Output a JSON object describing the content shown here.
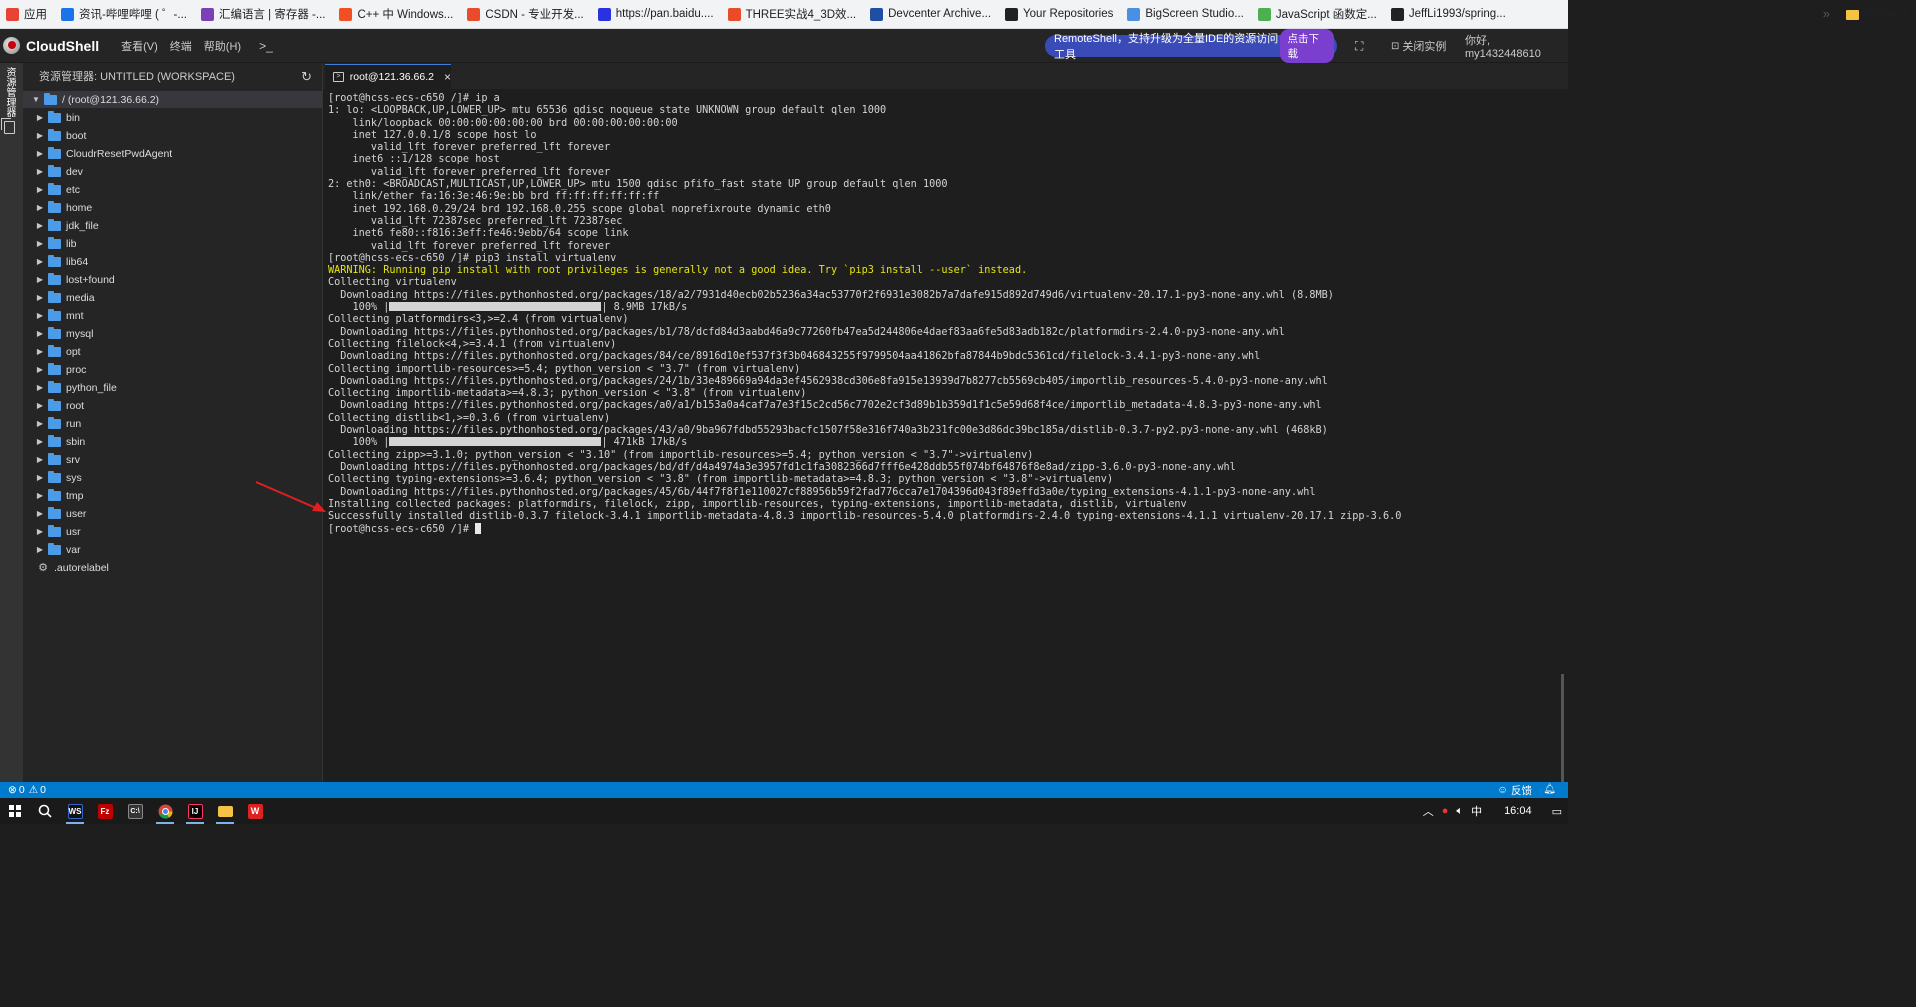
{
  "bookmarks": [
    {
      "label": "应用",
      "icon": "apps-grid-icon",
      "color": "#ea4335"
    },
    {
      "label": "资讯-哔哩哔哩 ( ゜-...",
      "icon": "bilibili-icon",
      "color": "#1a73e8"
    },
    {
      "label": "汇编语言 | 寄存器 -...",
      "icon": "visualstudio-icon",
      "color": "#7b3fb8"
    },
    {
      "label": "C++ 中 Windows...",
      "icon": "microsoft-icon",
      "color": "#f25022"
    },
    {
      "label": "CSDN - 专业开发...",
      "icon": "csdn-icon",
      "color": "#e94b2b"
    },
    {
      "label": "https://pan.baidu....",
      "icon": "baidu-icon",
      "color": "#2932e1"
    },
    {
      "label": "THREE实战4_3D效...",
      "icon": "csdn-icon",
      "color": "#e94b2b"
    },
    {
      "label": "Devcenter Archive...",
      "icon": "w-icon",
      "color": "#1f4fa3"
    },
    {
      "label": "Your Repositories",
      "icon": "github-icon",
      "color": "#222222"
    },
    {
      "label": "BigScreen Studio...",
      "icon": "bigscreen-icon",
      "color": "#4a90e2"
    },
    {
      "label": "JavaScript 函数定...",
      "icon": "globe-icon",
      "color": "#4caf50"
    },
    {
      "label": "JeffLi1993/spring...",
      "icon": "github-icon",
      "color": "#222222"
    }
  ],
  "bookmarks_more": "»",
  "bookmarks_all": "所有书签",
  "app": {
    "title": "CloudShell",
    "menus": [
      "查看(V)",
      "终端",
      "帮助(H)"
    ],
    "terminal_icon": "terminal-icon",
    "promo_text": "RemoteShell，支持升级为全量IDE的资源访问工具",
    "promo_button": "点击下载",
    "close_instance": "关闭实例",
    "greeting": "你好, my1432448610"
  },
  "activity": {
    "label": "资源管理器"
  },
  "explorer": {
    "header": "资源管理器: UNTITLED (WORKSPACE)",
    "root": "/ (root@121.36.66.2)",
    "items": [
      "bin",
      "boot",
      "CloudrResetPwdAgent",
      "dev",
      "etc",
      "home",
      "jdk_file",
      "lib",
      "lib64",
      "lost+found",
      "media",
      "mnt",
      "mysql",
      "opt",
      "proc",
      "python_file",
      "root",
      "run",
      "sbin",
      "srv",
      "sys",
      "tmp",
      "user",
      "usr",
      "var"
    ],
    "file": ".autorelabel"
  },
  "tab": {
    "label": "root@121.36.66.2",
    "close": "×"
  },
  "terminal": {
    "lines": [
      "[root@hcss-ecs-c650 /]# ip a",
      "1: lo: <LOOPBACK,UP,LOWER_UP> mtu 65536 qdisc noqueue state UNKNOWN group default qlen 1000",
      "    link/loopback 00:00:00:00:00:00 brd 00:00:00:00:00:00",
      "    inet 127.0.0.1/8 scope host lo",
      "       valid_lft forever preferred_lft forever",
      "    inet6 ::1/128 scope host",
      "       valid_lft forever preferred_lft forever",
      "2: eth0: <BROADCAST,MULTICAST,UP,LOWER_UP> mtu 1500 qdisc pfifo_fast state UP group default qlen 1000",
      "    link/ether fa:16:3e:46:9e:bb brd ff:ff:ff:ff:ff:ff",
      "    inet 192.168.0.29/24 brd 192.168.0.255 scope global noprefixroute dynamic eth0",
      "       valid_lft 72387sec preferred_lft 72387sec",
      "    inet6 fe80::f816:3eff:fe46:9ebb/64 scope link",
      "       valid_lft forever preferred_lft forever",
      "[root@hcss-ecs-c650 /]# pip3 install virtualenv",
      "WARNING: Running pip install with root privileges is generally not a good idea. Try `pip3 install --user` instead.",
      "Collecting virtualenv",
      "  Downloading https://files.pythonhosted.org/packages/18/a2/7931d40ecb02b5236a34ac53770f2f6931e3082b7a7dafe915d892d749d6/virtualenv-20.17.1-py3-none-any.whl (8.8MB)",
      "__BAR1__",
      "Collecting platformdirs<3,>=2.4 (from virtualenv)",
      "  Downloading https://files.pythonhosted.org/packages/b1/78/dcfd84d3aabd46a9c77260fb47ea5d244806e4daef83aa6fe5d83adb182c/platformdirs-2.4.0-py3-none-any.whl",
      "Collecting filelock<4,>=3.4.1 (from virtualenv)",
      "  Downloading https://files.pythonhosted.org/packages/84/ce/8916d10ef537f3f3b046843255f9799504aa41862bfa87844b9bdc5361cd/filelock-3.4.1-py3-none-any.whl",
      "Collecting importlib-resources>=5.4; python_version < \"3.7\" (from virtualenv)",
      "  Downloading https://files.pythonhosted.org/packages/24/1b/33e489669a94da3ef4562938cd306e8fa915e13939d7b8277cb5569cb405/importlib_resources-5.4.0-py3-none-any.whl",
      "Collecting importlib-metadata>=4.8.3; python_version < \"3.8\" (from virtualenv)",
      "  Downloading https://files.pythonhosted.org/packages/a0/a1/b153a0a4caf7a7e3f15c2cd56c7702e2cf3d89b1b359d1f1c5e59d68f4ce/importlib_metadata-4.8.3-py3-none-any.whl",
      "Collecting distlib<1,>=0.3.6 (from virtualenv)",
      "  Downloading https://files.pythonhosted.org/packages/43/a0/9ba967fdbd55293bacfc1507f58e316f740a3b231fc00e3d86dc39bc185a/distlib-0.3.7-py2.py3-none-any.whl (468kB)",
      "__BAR2__",
      "Collecting zipp>=3.1.0; python_version < \"3.10\" (from importlib-resources>=5.4; python_version < \"3.7\"->virtualenv)",
      "  Downloading https://files.pythonhosted.org/packages/bd/df/d4a4974a3e3957fd1c1fa3082366d7fff6e428ddb55f074bf64876f8e8ad/zipp-3.6.0-py3-none-any.whl",
      "Collecting typing-extensions>=3.6.4; python_version < \"3.8\" (from importlib-metadata>=4.8.3; python_version < \"3.8\"->virtualenv)",
      "  Downloading https://files.pythonhosted.org/packages/45/6b/44f7f8f1e110027cf88956b59f2fad776cca7e1704396d043f89effd3a0e/typing_extensions-4.1.1-py3-none-any.whl",
      "Installing collected packages: platformdirs, filelock, zipp, importlib-resources, typing-extensions, importlib-metadata, distlib, virtualenv",
      "Successfully installed distlib-0.3.7 filelock-3.4.1 importlib-metadata-4.8.3 importlib-resources-5.4.0 platformdirs-2.4.0 typing-extensions-4.1.1 virtualenv-20.17.1 zipp-3.6.0",
      "[root@hcss-ecs-c650 /]# "
    ],
    "progress": [
      {
        "percent": "100%",
        "rate": "8.9MB 17kB/s",
        "fill": 1.0
      },
      {
        "percent": "100%",
        "rate": "471kB 17kB/s",
        "fill": 1.0
      }
    ],
    "warning_color": "#e5e510",
    "annotation_arrow_color": "#e02020"
  },
  "statusbar": {
    "errors": "0",
    "warnings": "0",
    "feedback": "反馈",
    "color": "#007acc"
  },
  "taskbar": {
    "apps": [
      "windows-start-icon",
      "search-icon",
      "webstorm-icon",
      "filezilla-icon",
      "terminal-icon",
      "chrome-icon",
      "intellij-icon",
      "file-explorer-icon",
      "wps-icon"
    ],
    "tray_ime": "中",
    "tray_time": "16:04"
  }
}
